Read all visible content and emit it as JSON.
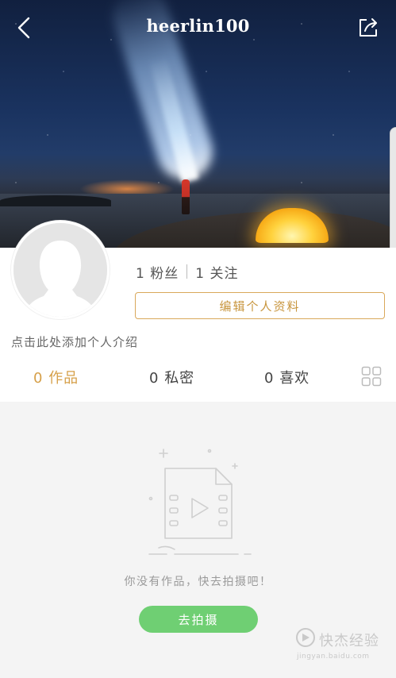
{
  "header": {
    "title": "heerlin100",
    "back_icon": "back-arrow-icon",
    "share_icon": "share-icon"
  },
  "profile": {
    "fans_count": "1",
    "fans_label": "粉丝",
    "following_count": "1",
    "following_label": "关注",
    "edit_label": "编辑个人资料",
    "intro_placeholder": "点击此处添加个人介绍"
  },
  "tabs": [
    {
      "count": "0",
      "label": "作品",
      "active": true
    },
    {
      "count": "0",
      "label": "私密",
      "active": false
    },
    {
      "count": "0",
      "label": "喜欢",
      "active": false
    }
  ],
  "empty_state": {
    "message": "你没有作品，快去拍摄吧！",
    "action_label": "去拍摄"
  },
  "watermark": {
    "text": "快杰经验",
    "sub": "jingyan.baidu.com"
  },
  "colors": {
    "accent": "#d6a04a",
    "green": "#6fcf73"
  }
}
